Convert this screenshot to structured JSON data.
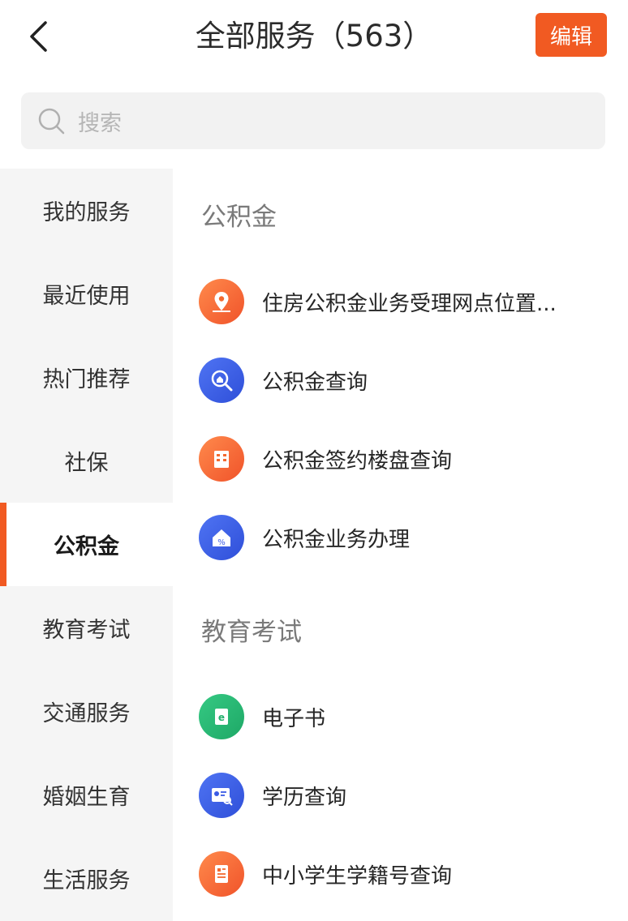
{
  "header": {
    "title": "全部服务（563）",
    "edit_label": "编辑"
  },
  "search": {
    "placeholder": "搜索"
  },
  "sidebar": {
    "items": [
      {
        "label": "我的服务"
      },
      {
        "label": "最近使用"
      },
      {
        "label": "热门推荐"
      },
      {
        "label": "社保"
      },
      {
        "label": "公积金",
        "active": true
      },
      {
        "label": "教育考试"
      },
      {
        "label": "交通服务"
      },
      {
        "label": "婚姻生育"
      },
      {
        "label": "生活服务"
      }
    ]
  },
  "sections": [
    {
      "title": "公积金",
      "services": [
        {
          "label": "住房公积金业务受理网点位置...",
          "icon": "map-pin-icon",
          "color": "orange"
        },
        {
          "label": "公积金查询",
          "icon": "search-house-icon",
          "color": "blue"
        },
        {
          "label": "公积金签约楼盘查询",
          "icon": "building-icon",
          "color": "orange"
        },
        {
          "label": "公积金业务办理",
          "icon": "house-percent-icon",
          "color": "blue"
        }
      ]
    },
    {
      "title": "教育考试",
      "services": [
        {
          "label": "电子书",
          "icon": "ebook-icon",
          "color": "green"
        },
        {
          "label": "学历查询",
          "icon": "certificate-search-icon",
          "color": "blue"
        },
        {
          "label": "中小学生学籍号查询",
          "icon": "document-icon",
          "color": "orange"
        }
      ]
    }
  ],
  "colors": {
    "accent": "#f15a22",
    "sidebar_bg": "#f5f5f5",
    "blue": "#3a5be5",
    "green": "#22b06d"
  }
}
